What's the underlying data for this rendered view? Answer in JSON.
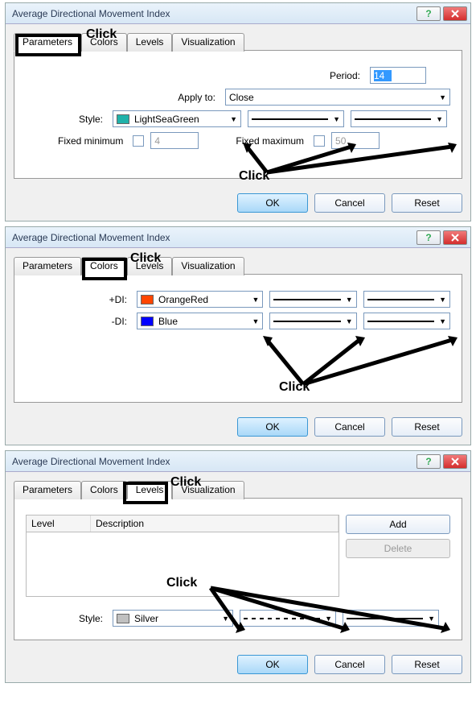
{
  "dialog_title": "Average Directional Movement Index",
  "tabs": {
    "parameters": "Parameters",
    "colors": "Colors",
    "levels": "Levels",
    "visualization": "Visualization"
  },
  "annotation": {
    "click": "Click"
  },
  "panel1": {
    "period_label": "Period:",
    "period_value": "14",
    "apply_label": "Apply to:",
    "apply_value": "Close",
    "style_label": "Style:",
    "style_value": "LightSeaGreen",
    "style_hex": "#20B2AA",
    "fixed_min_label": "Fixed minimum",
    "fixed_min_value": "4",
    "fixed_max_label": "Fixed maximum",
    "fixed_max_value": "50",
    "buttons": {
      "ok": "OK",
      "cancel": "Cancel",
      "reset": "Reset"
    }
  },
  "panel2": {
    "plus_di_label": "+DI:",
    "plus_di_value": "OrangeRed",
    "plus_di_hex": "#FF4500",
    "minus_di_label": "-DI:",
    "minus_di_value": "Blue",
    "minus_di_hex": "#0000FF",
    "buttons": {
      "ok": "OK",
      "cancel": "Cancel",
      "reset": "Reset"
    }
  },
  "panel3": {
    "col_level": "Level",
    "col_desc": "Description",
    "add_label": "Add",
    "delete_label": "Delete",
    "style_label": "Style:",
    "style_value": "Silver",
    "style_hex": "#C0C0C0",
    "buttons": {
      "ok": "OK",
      "cancel": "Cancel",
      "reset": "Reset"
    }
  }
}
